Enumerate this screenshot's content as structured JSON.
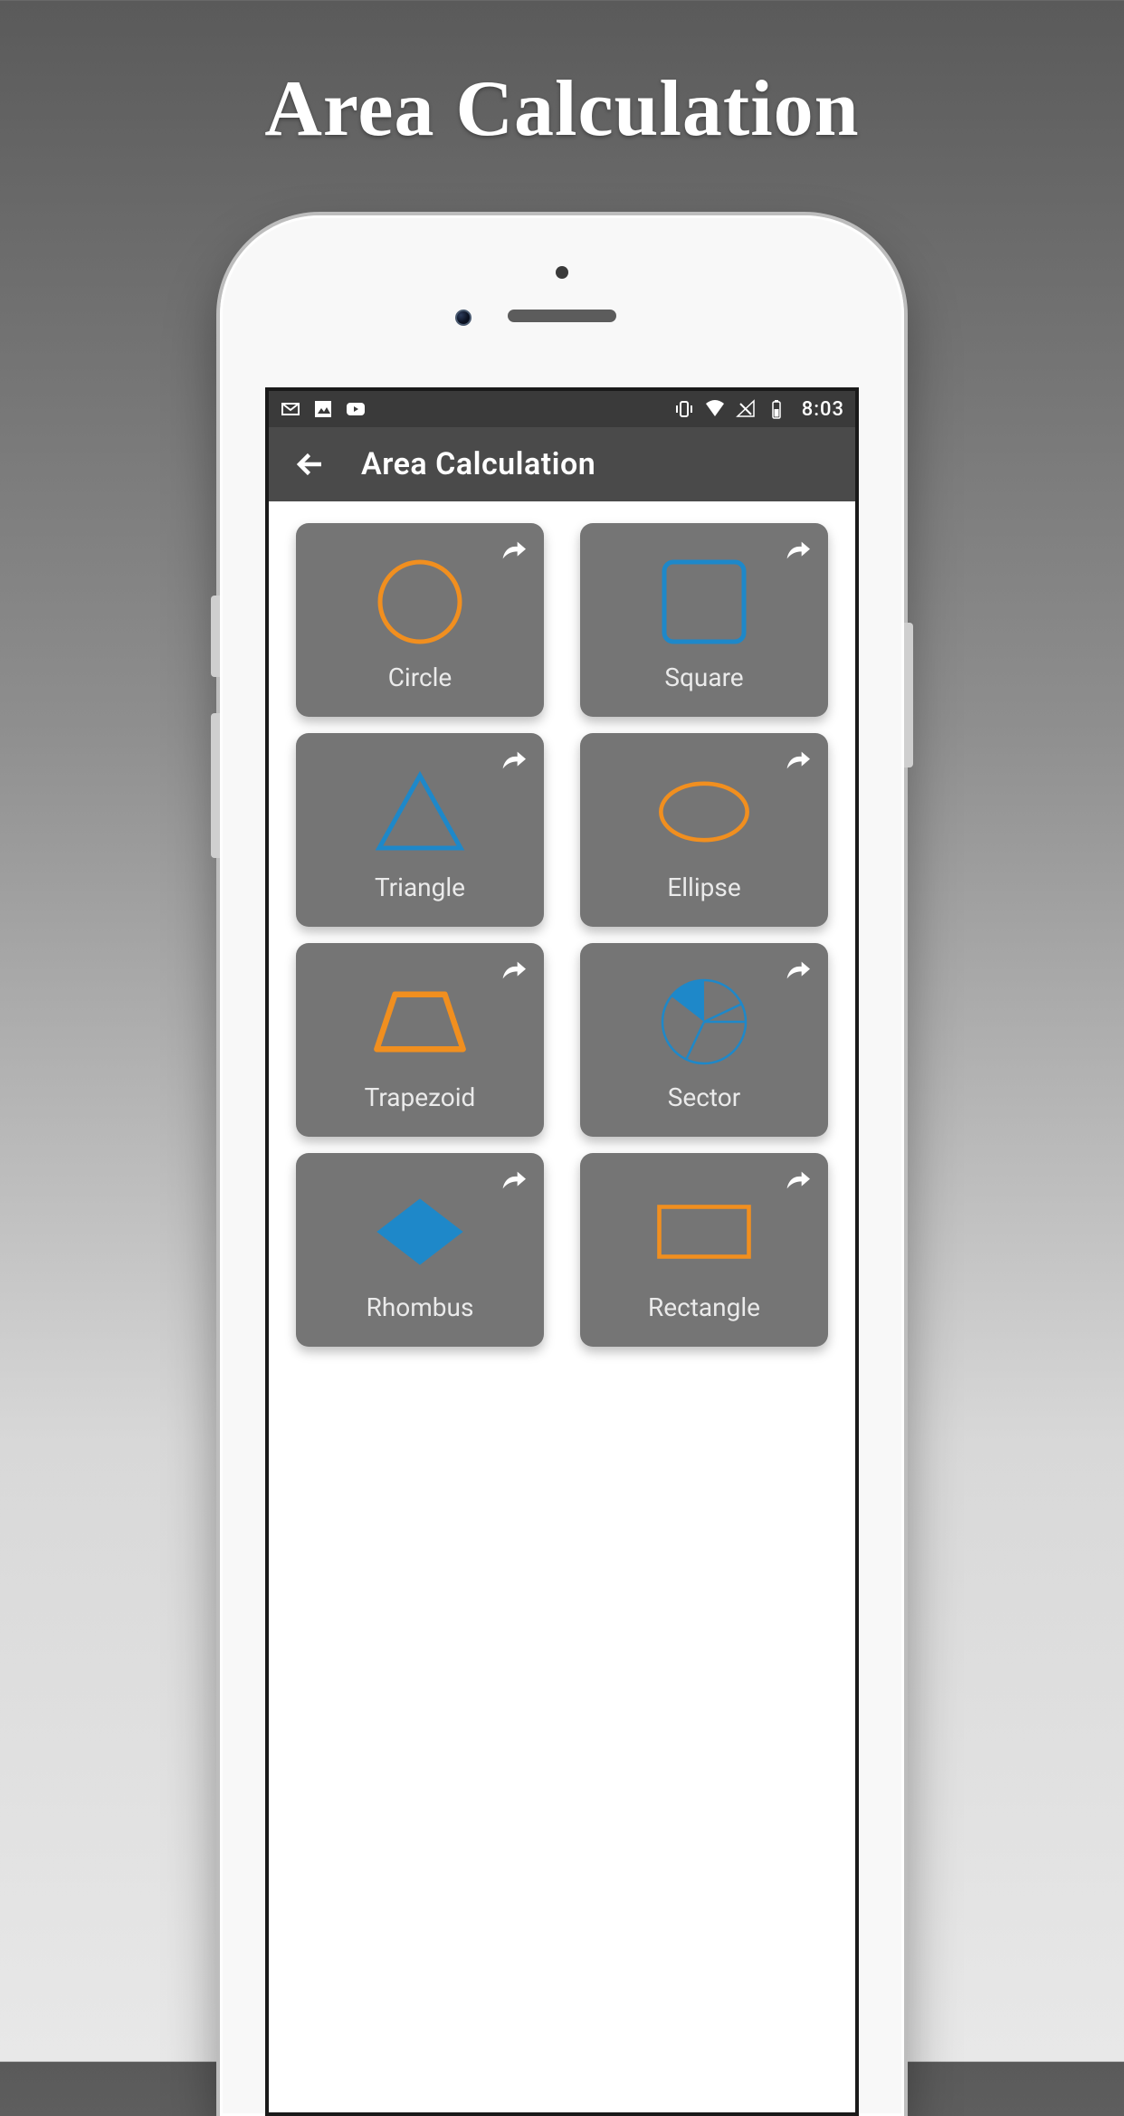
{
  "page": {
    "heading": "Area Calculation"
  },
  "statusbar": {
    "time": "8:03"
  },
  "appbar": {
    "title": "Area Calculation"
  },
  "colors": {
    "orange": "#f18f1f",
    "blue": "#1e88c9",
    "card_bg": "#757575"
  },
  "shapes": [
    {
      "key": "circle",
      "label": "Circle"
    },
    {
      "key": "square",
      "label": "Square"
    },
    {
      "key": "triangle",
      "label": "Triangle"
    },
    {
      "key": "ellipse",
      "label": "Ellipse"
    },
    {
      "key": "trapezoid",
      "label": "Trapezoid"
    },
    {
      "key": "sector",
      "label": "Sector"
    },
    {
      "key": "rhombus",
      "label": "Rhombus"
    },
    {
      "key": "rectangle",
      "label": "Rectangle"
    }
  ]
}
